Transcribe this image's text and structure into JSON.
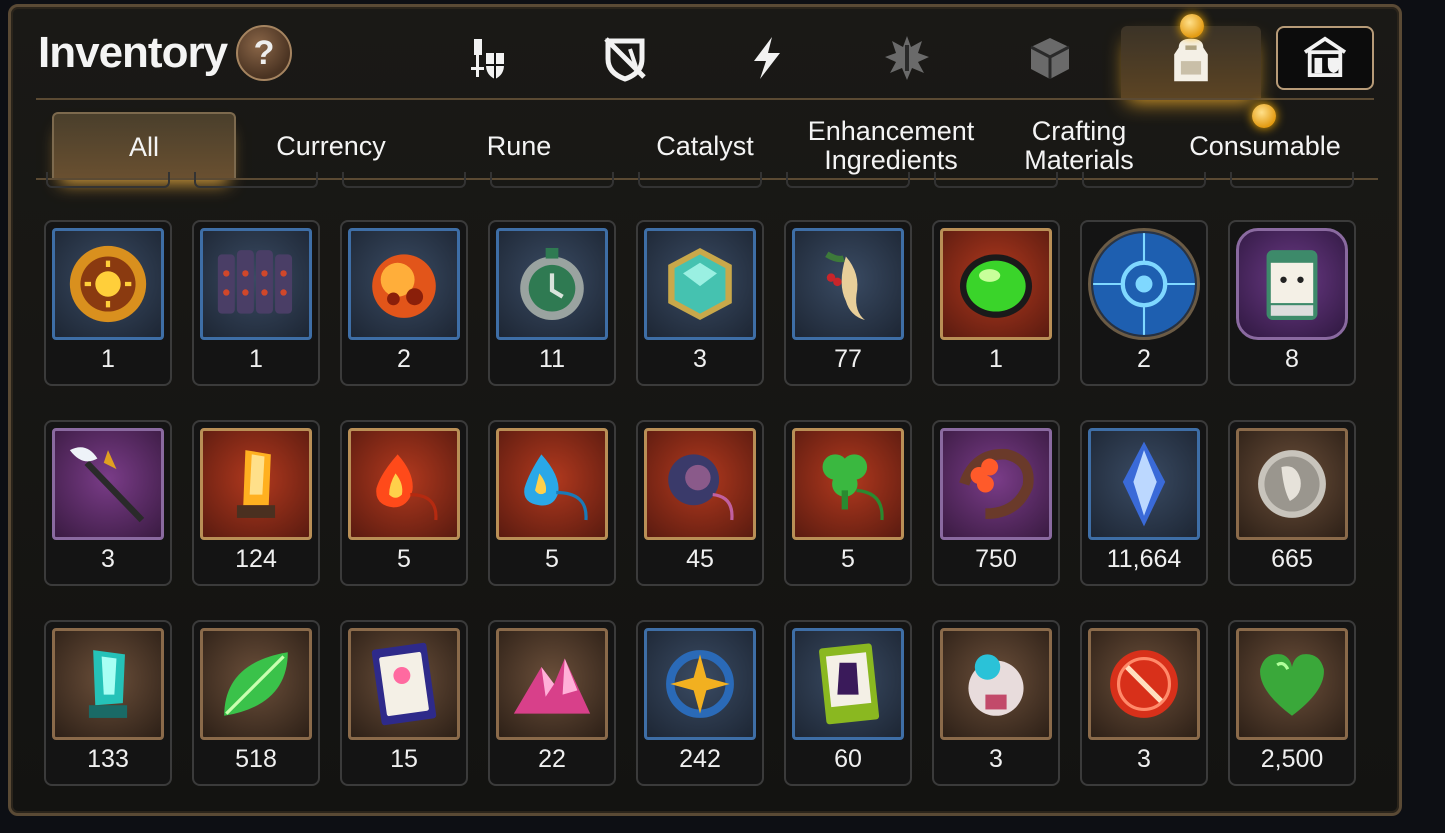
{
  "header": {
    "title": "Inventory",
    "help_label": "?"
  },
  "category_tabs": [
    {
      "icon": "knight-shield-icon"
    },
    {
      "icon": "broken-shield-icon"
    },
    {
      "icon": "lightning-icon"
    },
    {
      "icon": "spiky-sword-icon"
    },
    {
      "icon": "cube-icon"
    },
    {
      "icon": "backpack-icon"
    },
    {
      "icon": "guild-house-icon"
    }
  ],
  "sub_tabs": [
    {
      "label": "All"
    },
    {
      "label": "Currency"
    },
    {
      "label": "Rune"
    },
    {
      "label": "Catalyst"
    },
    {
      "label_line1": "Enhancement",
      "label_line2": "Ingredients"
    },
    {
      "label_line1": "Crafting",
      "label_line2": "Materials"
    },
    {
      "label": "Consumable"
    }
  ],
  "items": [
    {
      "icon": "sun-coin-icon",
      "qty": "1"
    },
    {
      "icon": "stone-tablets-icon",
      "qty": "1"
    },
    {
      "icon": "fire-orb-icon",
      "qty": "2"
    },
    {
      "icon": "green-clock-icon",
      "qty": "11"
    },
    {
      "icon": "teal-gem-icon",
      "qty": "3"
    },
    {
      "icon": "ginseng-root-icon",
      "qty": "77"
    },
    {
      "icon": "green-potion-icon",
      "qty": "1"
    },
    {
      "icon": "blue-rune-circle-icon",
      "qty": "2"
    },
    {
      "icon": "pet-food-bag-icon",
      "qty": "8"
    },
    {
      "icon": "feather-wand-icon",
      "qty": "3"
    },
    {
      "icon": "amber-crystal-icon",
      "qty": "124"
    },
    {
      "icon": "flame-pendant-icon",
      "qty": "5"
    },
    {
      "icon": "water-drop-pendant-icon",
      "qty": "5"
    },
    {
      "icon": "moon-ring-pendant-icon",
      "qty": "45"
    },
    {
      "icon": "clover-pendant-icon",
      "qty": "5"
    },
    {
      "icon": "flower-bracelet-icon",
      "qty": "750"
    },
    {
      "icon": "blue-crystal-shard-icon",
      "qty": "11,664"
    },
    {
      "icon": "silver-coin-icon",
      "qty": "665"
    },
    {
      "icon": "cyan-crystal-icon",
      "qty": "133"
    },
    {
      "icon": "green-leaf-icon",
      "qty": "518"
    },
    {
      "icon": "purple-card-icon",
      "qty": "15"
    },
    {
      "icon": "pink-crystal-pile-icon",
      "qty": "22"
    },
    {
      "icon": "star-pendant-icon",
      "qty": "242"
    },
    {
      "icon": "green-costume-card-icon",
      "qty": "60"
    },
    {
      "icon": "robot-drone-icon",
      "qty": "3"
    },
    {
      "icon": "red-seal-icon",
      "qty": "3"
    },
    {
      "icon": "green-heart-icon",
      "qty": "2,500"
    }
  ],
  "colors": {
    "accent_gold": "#e2a32a",
    "border_bronze": "#5a4a35",
    "frame_blue": "#3e6ea6"
  }
}
